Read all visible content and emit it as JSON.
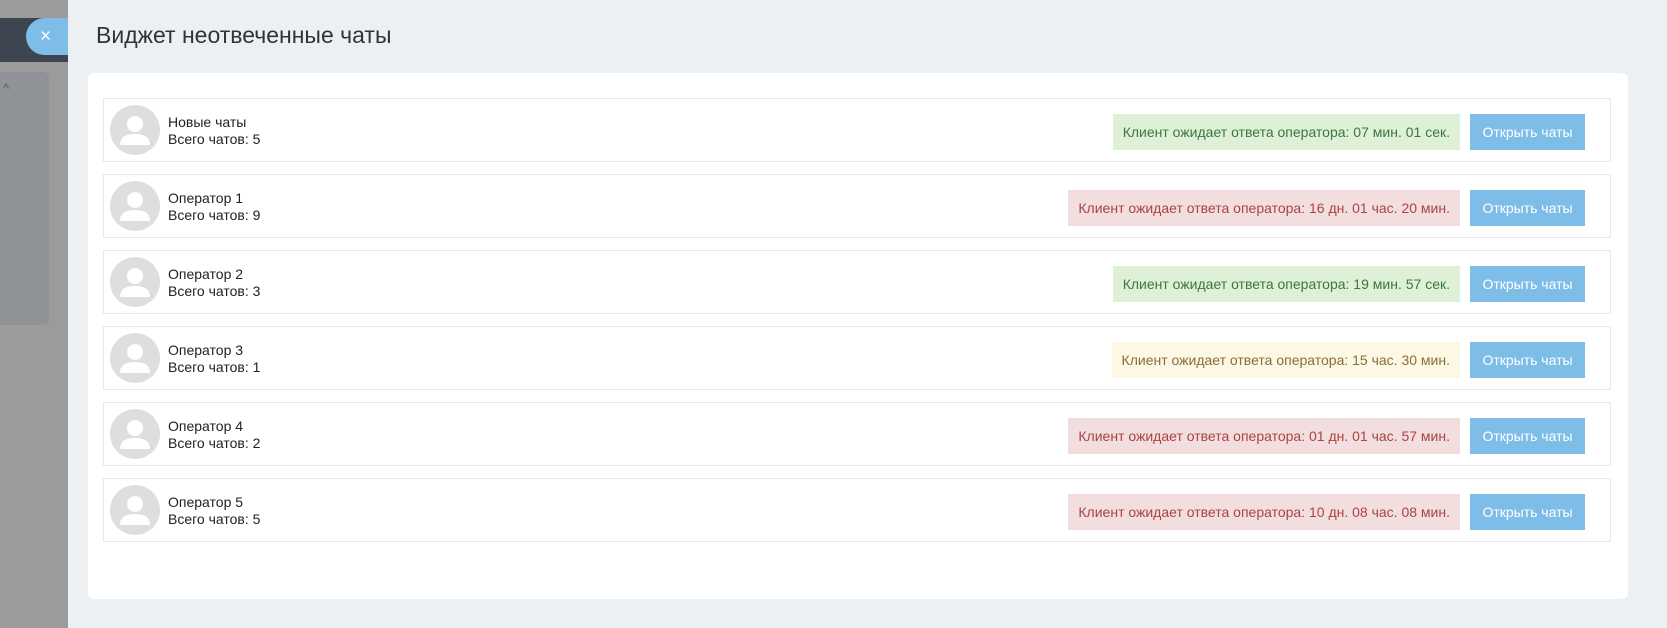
{
  "modal": {
    "title": "Виджет неотвеченные чаты",
    "close_label": "×"
  },
  "background": {
    "chevron": "^"
  },
  "rows": [
    {
      "name": "Новые чаты",
      "total": "Всего чатов: 5",
      "status": "Клиент ожидает ответа оператора: 07 мин. 01 сек.",
      "status_level": "green",
      "button": "Открыть чаты"
    },
    {
      "name": "Оператор 1",
      "total": "Всего чатов: 9",
      "status": "Клиент ожидает ответа оператора: 16 дн. 01 час. 20 мин.",
      "status_level": "red",
      "button": "Открыть чаты"
    },
    {
      "name": "Оператор 2",
      "total": "Всего чатов: 3",
      "status": "Клиент ожидает ответа оператора: 19 мин. 57 сек.",
      "status_level": "green",
      "button": "Открыть чаты"
    },
    {
      "name": "Оператор 3",
      "total": "Всего чатов: 1",
      "status": "Клиент ожидает ответа оператора: 15 час. 30 мин.",
      "status_level": "yellow",
      "button": "Открыть чаты"
    },
    {
      "name": "Оператор 4",
      "total": "Всего чатов: 2",
      "status": "Клиент ожидает ответа оператора: 01 дн. 01 час. 57 мин.",
      "status_level": "red",
      "button": "Открыть чаты"
    },
    {
      "name": "Оператор 5",
      "total": "Всего чатов: 5",
      "status": "Клиент ожидает ответа оператора: 10 дн. 08 час. 08 мин.",
      "status_level": "red",
      "button": "Открыть чаты"
    }
  ],
  "colors": {
    "accent": "#7fbde9",
    "status_green_bg": "#dff0d8",
    "status_red_bg": "#f2dede",
    "status_yellow_bg": "#fcf8e3"
  },
  "icons": {
    "avatar": "user-silhouette-icon",
    "close": "close-icon",
    "chevron": "chevron-up-icon"
  }
}
